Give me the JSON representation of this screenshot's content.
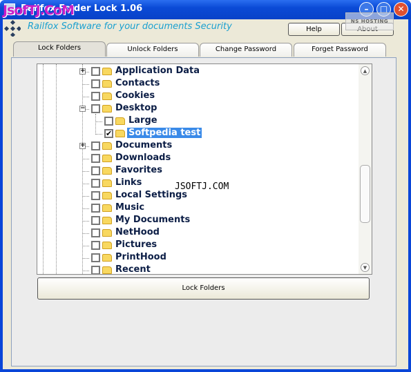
{
  "window": {
    "title": "Railfox Folder Lock 1.06",
    "watermark": "JsofTJ.CoM",
    "controls": [
      "minimize",
      "maximize",
      "close"
    ]
  },
  "header": {
    "slogan": "Railfox Software for your documents Security",
    "help": "Help",
    "about": "About",
    "hosting_badge": "NS HOSTING"
  },
  "tabs": [
    {
      "label": "Lock Folders",
      "active": true
    },
    {
      "label": "Unlock Folders"
    },
    {
      "label": "Change Password"
    },
    {
      "label": "Forget Password"
    }
  ],
  "tree": {
    "items": [
      {
        "label": "Application Data",
        "level": 1,
        "expander": "+",
        "checked": false
      },
      {
        "label": "Contacts",
        "level": 1,
        "checked": false
      },
      {
        "label": "Cookies",
        "level": 1,
        "checked": false
      },
      {
        "label": "Desktop",
        "level": 1,
        "expander": "-",
        "checked": false
      },
      {
        "label": "Large",
        "level": 2,
        "checked": false
      },
      {
        "label": "Softpedia test",
        "level": 2,
        "checked": true,
        "selected": true
      },
      {
        "label": "Documents",
        "level": 1,
        "expander": "+",
        "checked": false
      },
      {
        "label": "Downloads",
        "level": 1,
        "checked": false
      },
      {
        "label": "Favorites",
        "level": 1,
        "checked": false
      },
      {
        "label": "Links",
        "level": 1,
        "checked": false
      },
      {
        "label": "Local Settings",
        "level": 1,
        "checked": false
      },
      {
        "label": "Music",
        "level": 1,
        "checked": false
      },
      {
        "label": "My Documents",
        "level": 1,
        "checked": false
      },
      {
        "label": "NetHood",
        "level": 1,
        "checked": false
      },
      {
        "label": "Pictures",
        "level": 1,
        "checked": false
      },
      {
        "label": "PrintHood",
        "level": 1,
        "checked": false
      },
      {
        "label": "Recent",
        "level": 1,
        "checked": false
      }
    ]
  },
  "overlay_text": "JSOFTJ.COM",
  "action": {
    "lock": "Lock Folders"
  }
}
